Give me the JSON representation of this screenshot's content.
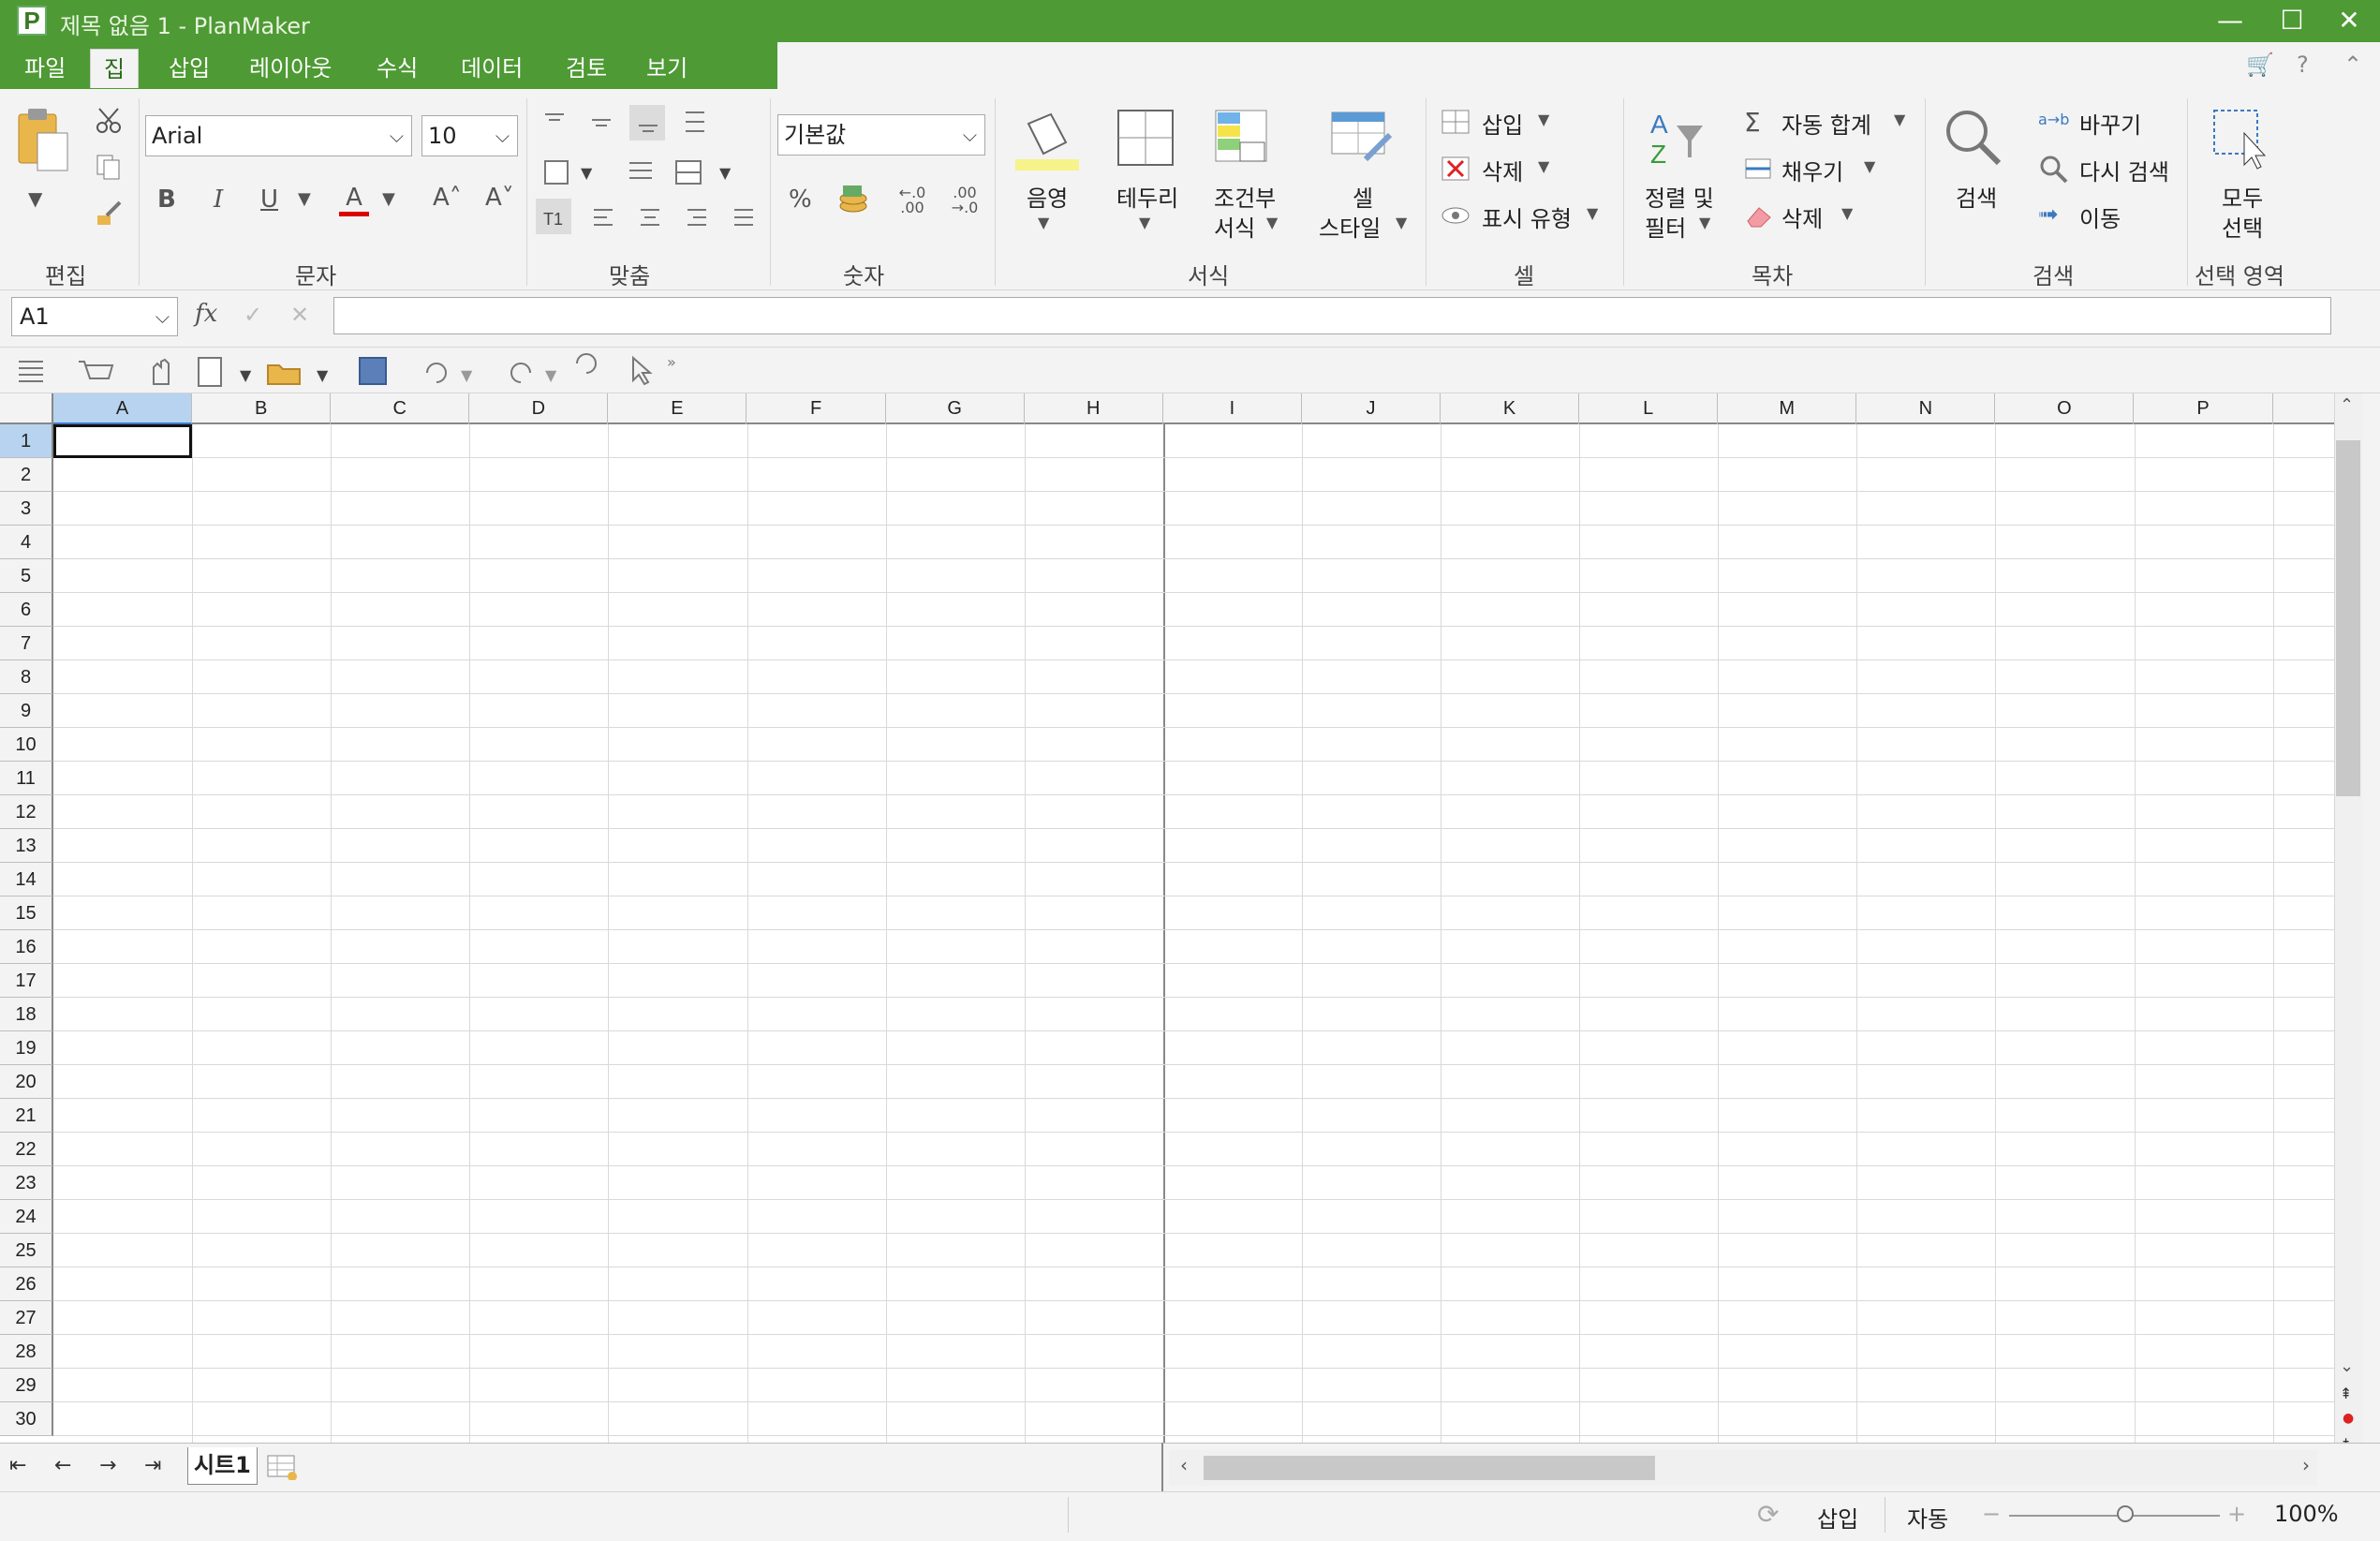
{
  "window": {
    "app_icon_letter": "P",
    "title": "제목 없음 1 - PlanMaker",
    "minimize_glyph": "—",
    "maximize_glyph": "☐",
    "close_glyph": "✕"
  },
  "menu": {
    "tabs": [
      "파일",
      "집",
      "삽입",
      "레이아웃",
      "수식",
      "데이터",
      "검토",
      "보기"
    ],
    "active_tab": "집",
    "right_icons": [
      "cart-icon",
      "help-icon",
      "collapse-ribbon-icon"
    ],
    "help_glyph": "?",
    "collapse_glyph": "⌃",
    "cart_glyph": "🛒"
  },
  "ribbon": {
    "groups": {
      "edit": "편집",
      "text": "문자",
      "align": "맞춤",
      "number": "숫자",
      "format": "서식",
      "cell": "셀",
      "table": "목차",
      "search": "검색",
      "select": "선택 영역"
    },
    "font_name": "Arial",
    "font_size": "10",
    "number_format": "기본값",
    "text_buttons": {
      "bold": "B",
      "italic": "I",
      "underline": "U",
      "font_color": "A",
      "grow": "A˄",
      "shrink": "A˅"
    },
    "number_buttons": {
      "percent": "%",
      "inc_decimal": "←.0 .00",
      "dec_decimal": ".00 →.0"
    },
    "format_buttons": {
      "shading": "음영",
      "borders": "테두리",
      "conditional_1": "조건부",
      "conditional_2": "서식",
      "cell_style_1": "셀",
      "cell_style_2": "스타일"
    },
    "cell_buttons": {
      "insert": "삽입",
      "delete": "삭제",
      "display_type": "표시 유형"
    },
    "table_buttons": {
      "sort_1": "정렬 및",
      "sort_2": "필터",
      "autosum": "자동 합계",
      "fill": "채우기",
      "delete": "삭제"
    },
    "search_buttons": {
      "find": "검색",
      "replace": "바꾸기",
      "find_again": "다시 검색",
      "goto": "이동"
    },
    "select_buttons": {
      "select_all_1": "모두",
      "select_all_2": "선택"
    }
  },
  "formula_bar": {
    "cell_ref": "A1",
    "fx": "fx",
    "confirm": "✓",
    "cancel": "✕",
    "value": ""
  },
  "grid": {
    "columns": [
      "A",
      "B",
      "C",
      "D",
      "E",
      "F",
      "G",
      "H",
      "I",
      "J",
      "K",
      "L",
      "M",
      "N",
      "O",
      "P"
    ],
    "rows": [
      "1",
      "2",
      "3",
      "4",
      "5",
      "6",
      "7",
      "8",
      "9",
      "10",
      "11",
      "12",
      "13",
      "14",
      "15",
      "16",
      "17",
      "18",
      "19",
      "20",
      "21",
      "22",
      "23",
      "24",
      "25",
      "26",
      "27",
      "28",
      "29",
      "30"
    ],
    "selected_cell": "A1"
  },
  "sheets": {
    "tabs": [
      "시트1"
    ],
    "active": "시트1"
  },
  "statusbar": {
    "insert_mode": "삽입",
    "calc_mode": "자동",
    "zoom": "100%",
    "zoom_minus": "−",
    "zoom_plus": "+",
    "zoom_fraction": 0.55
  }
}
